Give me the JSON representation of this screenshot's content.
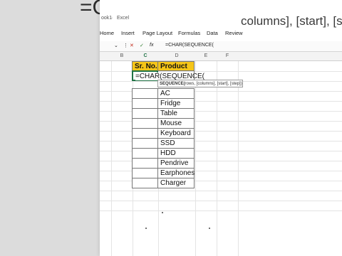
{
  "overlay": {
    "formula_left": "=C",
    "formula_right": "columns], [start], [ste"
  },
  "excel": {
    "title_left": "ook1",
    "title_sep": "·",
    "title_app": "Excel",
    "tabs": [
      "Home",
      "Insert",
      "Page Layout",
      "Formulas",
      "Data",
      "Review"
    ],
    "name_box_chevron": "⌄",
    "formula_bar_more": "⋮",
    "fx_label": "fx",
    "formula_text": "=CHAR(SEQUENCE(",
    "columns": [
      "B",
      "C",
      "D",
      "E",
      "F"
    ],
    "headers": {
      "sr_no": "Sr. No.",
      "product": "Product"
    },
    "editing_cell": "=CHAR(SEQUENCE(",
    "tooltip": {
      "fn": "SEQUENCE(",
      "args": "rows, [columns], [start], [step])"
    },
    "products": [
      "AC",
      "Fridge",
      "Table",
      "Mouse",
      "Keyboard",
      "SSD",
      "HDD",
      "Pendrive",
      "Earphones",
      "Charger"
    ]
  }
}
